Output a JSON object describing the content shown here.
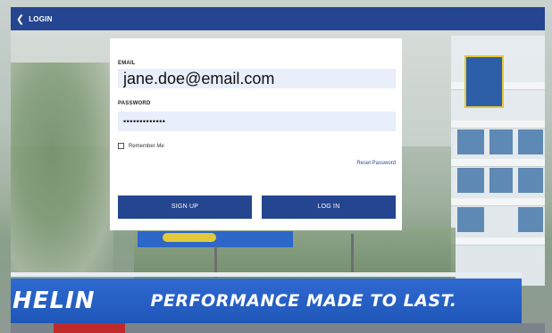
{
  "topbar": {
    "back_icon": "chevron-left-icon",
    "back_glyph": "❮",
    "title": "LOGIN",
    "color": "#24458f"
  },
  "form": {
    "email_label": "EMAIL",
    "email_value": "jane.doe@email.com",
    "password_label": "PASSWORD",
    "password_value": "•••••••••••••",
    "remember_label": "Remember Me",
    "remember_checked": false,
    "reset_link": "Reset Password",
    "signup_label": "SIGN UP",
    "login_label": "LOG IN"
  },
  "background": {
    "banner_left_text": "HELIN",
    "banner_right_text": "PERFORMANCE MADE TO LAST."
  },
  "colors": {
    "primary": "#24458f",
    "input_bg": "#e8eefa",
    "link": "#2a4b9a"
  }
}
